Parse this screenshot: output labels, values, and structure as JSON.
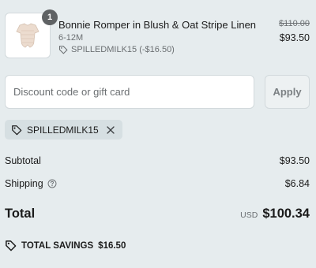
{
  "cart_item": {
    "quantity": "1",
    "name": "Bonnie Romper in Blush & Oat Stripe Linen",
    "variant": "6-12M",
    "discount_note": "SPILLEDMILK15 (-$16.50)",
    "original_price": "$110.00",
    "final_price": "$93.50"
  },
  "discount_form": {
    "placeholder": "Discount code or gift card",
    "apply_label": "Apply"
  },
  "applied_code": {
    "code": "SPILLEDMILK15"
  },
  "summary": {
    "subtotal_label": "Subtotal",
    "subtotal_value": "$93.50",
    "shipping_label": "Shipping",
    "shipping_value": "$6.84",
    "total_label": "Total",
    "currency": "USD",
    "total_value": "$100.34",
    "savings_label": "TOTAL SAVINGS",
    "savings_value": "$16.50"
  },
  "colors": {
    "background": "#e6ecee",
    "chip": "#d6dfe2",
    "badge": "#5f6264"
  }
}
